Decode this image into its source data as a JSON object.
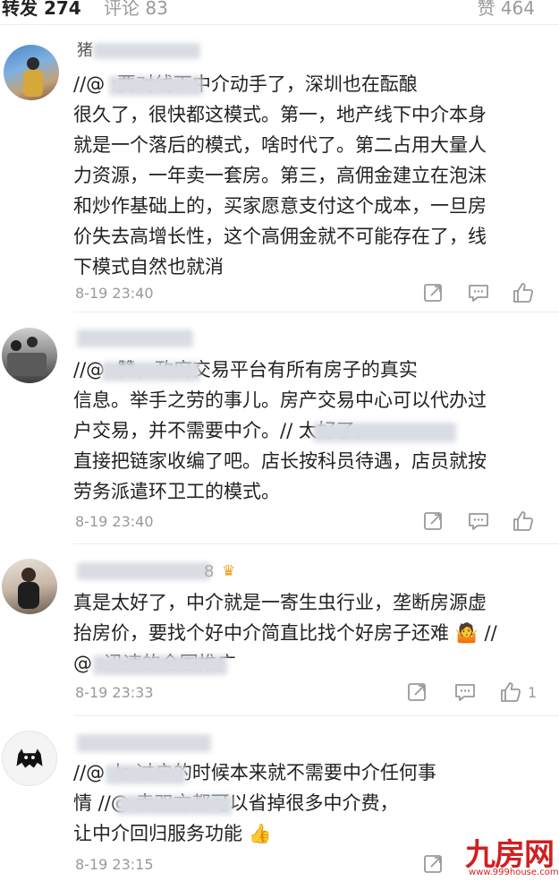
{
  "tabs": {
    "repost": "转发 274",
    "comment": "评论 83",
    "like": "赞 464"
  },
  "comments": [
    {
      "name_prefix": "猪",
      "lines": [
        "//@                 :要对线下中介动手了，深圳也在酝酿",
        "很久了，很快都这模式。第一，地产线下中介本身",
        "就是一个落后的模式，啥时代了。第二占用大量人",
        "力资源，一年卖一套房。第三，高佣金建立在泡沫",
        "和炒作基础上的，买家愿意支付这个成本，一旦房",
        "价失去高增长性，这个高佣金就不可能存在了，线",
        "下模式自然也就消"
      ],
      "time": "8-19 23:40",
      "likes": ""
    },
    {
      "name_prefix": "",
      "lines": [
        "//@                :赞，政府交易平台有所有房子的真实",
        "信息。举手之劳的事儿。房产交易中心可以代办过",
        "户交易，并不需要中介。//                      太好了，",
        "直接把链家收编了吧。店长按科员待遇，店员就按",
        "劳务派遣环卫工的模式。"
      ],
      "time": "8-19 23:40",
      "likes": ""
    },
    {
      "name_prefix": "",
      "name_suffix": "8",
      "lines": [
        "真是太好了，中介就是一寄生虫行业，垄断房源虚",
        "抬房价，要找个好中介简直比找个好房子还难 🤷 //",
        "@                    :迅速的全国推广"
      ],
      "time": "8-19 23:33",
      "likes": "1"
    },
    {
      "name_prefix": "",
      "lines": [
        "//@          七:过户的时候本来就不需要中介任何事",
        "情 //@                卖双方都可以省掉很多中介费，",
        "让中介回归服务功能 👍"
      ],
      "time": "8-19 23:15",
      "likes": ""
    }
  ],
  "watermark": {
    "main": "九房网",
    "sub": "www.999house.com"
  },
  "colors": {
    "text": "#222222",
    "muted": "#999999",
    "watermark": "#d21f1f"
  },
  "icons": [
    "repost-icon",
    "comment-icon",
    "like-icon"
  ]
}
